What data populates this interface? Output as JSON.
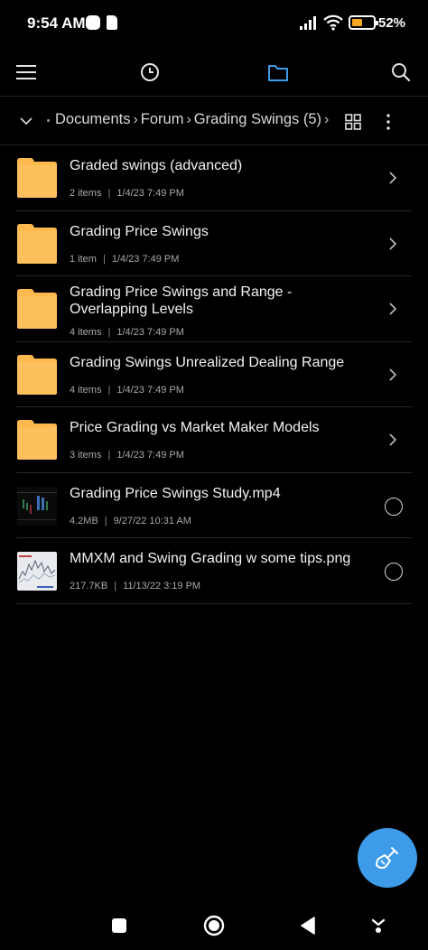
{
  "status_bar": {
    "time": "9:54 AM",
    "battery_text": "52%",
    "battery_level": 0.52,
    "battery_color": "#f5a623"
  },
  "toolbar": {
    "icons": [
      "menu-icon",
      "recent-clock-icon",
      "folder-icon",
      "search-icon"
    ],
    "active_color": "#3d9be9"
  },
  "breadcrumb": {
    "items": [
      "Documents",
      "Forum",
      "Grading Swings (5)"
    ]
  },
  "files": [
    {
      "type": "folder",
      "name": "Graded swings (advanced)",
      "size": "2 items",
      "date": "1/4/23 7:49 PM"
    },
    {
      "type": "folder",
      "name": "Grading Price Swings",
      "size": "1 item",
      "date": "1/4/23 7:49 PM"
    },
    {
      "type": "folder",
      "name": "Grading Price Swings and Range - Overlapping Levels",
      "size": "4 items",
      "date": "1/4/23 7:49 PM"
    },
    {
      "type": "folder",
      "name": "Grading Swings  Unrealized Dealing Range",
      "size": "4 items",
      "date": "1/4/23 7:49 PM"
    },
    {
      "type": "folder",
      "name": "Price Grading vs Market Maker Models",
      "size": "3 items",
      "date": "1/4/23 7:49 PM"
    },
    {
      "type": "video",
      "name": "Grading Price Swings Study.mp4",
      "size": "4.2MB",
      "date": "9/27/22 10:31 AM"
    },
    {
      "type": "image",
      "name": "MMXM and Swing Grading w some tips.png",
      "size": "217.7KB",
      "date": "11/13/22 3:19 PM"
    }
  ],
  "colors": {
    "folder": "#fdb94e",
    "fab": "#3d9be9",
    "background": "#000000"
  }
}
